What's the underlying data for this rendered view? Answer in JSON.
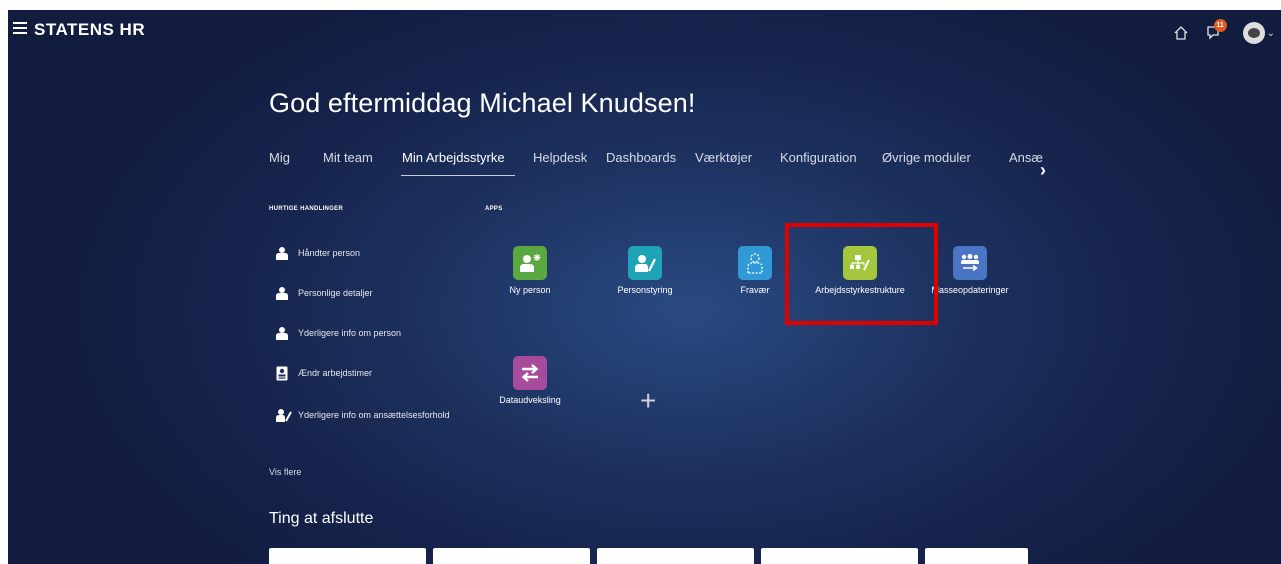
{
  "header": {
    "brand": "STATENS HR",
    "notification_count": "11"
  },
  "greeting": "God eftermiddag Michael Knudsen!",
  "tabs": [
    {
      "label": "Mig"
    },
    {
      "label": "Mit team"
    },
    {
      "label": "Min Arbejdsstyrke"
    },
    {
      "label": "Helpdesk"
    },
    {
      "label": "Dashboards"
    },
    {
      "label": "Værktøjer"
    },
    {
      "label": "Konfiguration"
    },
    {
      "label": "Øvrige moduler"
    },
    {
      "label": "Ansæ"
    }
  ],
  "quick_actions": {
    "heading": "HURTIGE HANDLINGER",
    "items": [
      {
        "label": "Håndter person"
      },
      {
        "label": "Personlige detaljer"
      },
      {
        "label": "Yderligere info om person"
      },
      {
        "label": "Ændr arbejdstimer"
      },
      {
        "label": "Yderligere info om ansættelsesforhold"
      }
    ],
    "more": "Vis flere"
  },
  "apps": {
    "heading": "APPS",
    "items": [
      {
        "label": "Ny person",
        "color": "#5aa83f"
      },
      {
        "label": "Personstyring",
        "color": "#1fa4b7"
      },
      {
        "label": "Fravær",
        "color": "#2f9ad6"
      },
      {
        "label": "Arbejdsstyrkestrukture",
        "color": "#a3c63c"
      },
      {
        "label": "Masseopdateringer",
        "color": "#4a74c4"
      },
      {
        "label": "Dataudveksling",
        "color": "#a64c9a"
      }
    ]
  },
  "bottom": {
    "title": "Ting at afslutte"
  }
}
